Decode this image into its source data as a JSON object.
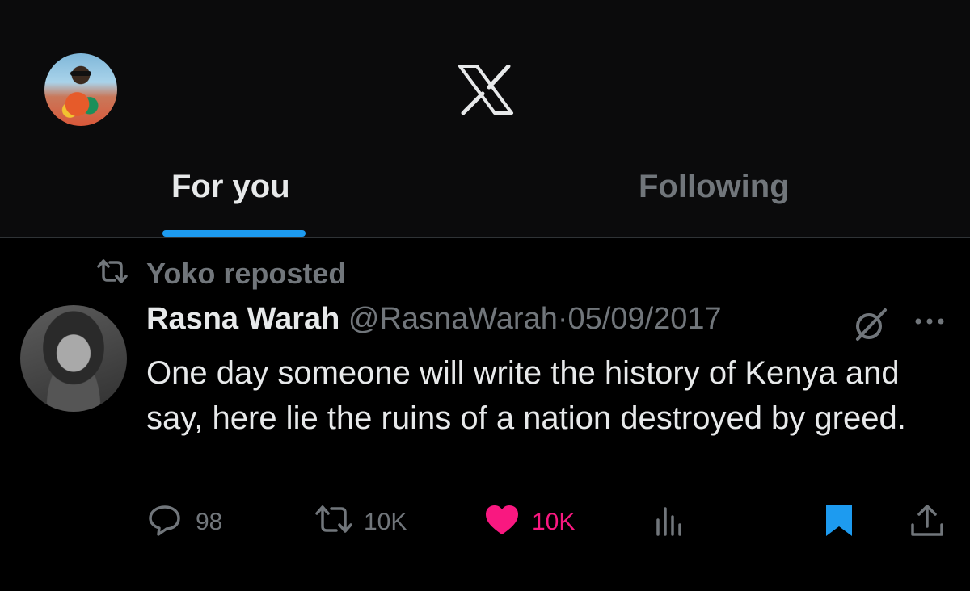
{
  "header": {
    "logo_icon": "x-logo-icon",
    "avatar": "user-avatar"
  },
  "tabs": [
    {
      "label": "For you",
      "active": true
    },
    {
      "label": "Following",
      "active": false
    }
  ],
  "colors": {
    "accent": "#1d9bf0",
    "like": "#f91880",
    "muted": "#71767b",
    "text": "#e7e9ea",
    "background": "#000000"
  },
  "tweet": {
    "social_context": "Yoko reposted",
    "author_name": "Rasna Warah",
    "author_handle": "@RasnaWarah",
    "separator": "·",
    "date": "05/09/2017",
    "text": "One day someone will write the history of Kenya and say, here lie the ruins of a nation destroyed by greed.",
    "actions": {
      "replies": "98",
      "reposts": "10K",
      "likes": "10K",
      "liked": true,
      "bookmarked": true
    }
  }
}
